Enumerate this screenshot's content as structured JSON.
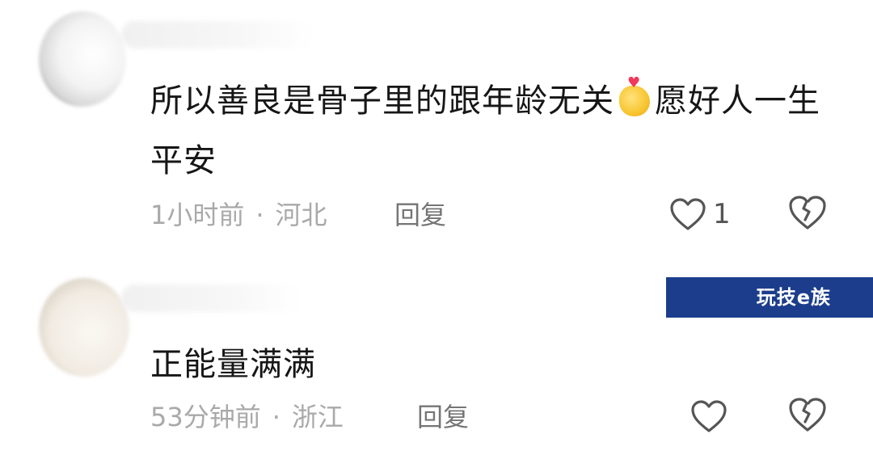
{
  "comments": [
    {
      "text_part1": "所以善良是骨子里的跟年龄无关",
      "emoji": "heart-hands-emoji",
      "text_part2": "愿好人一生平安",
      "time": "1小时前",
      "separator": "·",
      "location": "河北",
      "reply_label": "回复",
      "like_count": "1"
    },
    {
      "text": "正能量满满",
      "time": "53分钟前",
      "separator": "·",
      "location": "浙江",
      "reply_label": "回复",
      "like_count": ""
    }
  ],
  "watermark": "玩技e族",
  "colors": {
    "text": "#161616",
    "meta": "#a9a9a9",
    "icon": "#555555",
    "watermark_bg": "#1b3d8c"
  },
  "icons": {
    "like": "heart-outline-icon",
    "dislike": "broken-heart-icon"
  }
}
